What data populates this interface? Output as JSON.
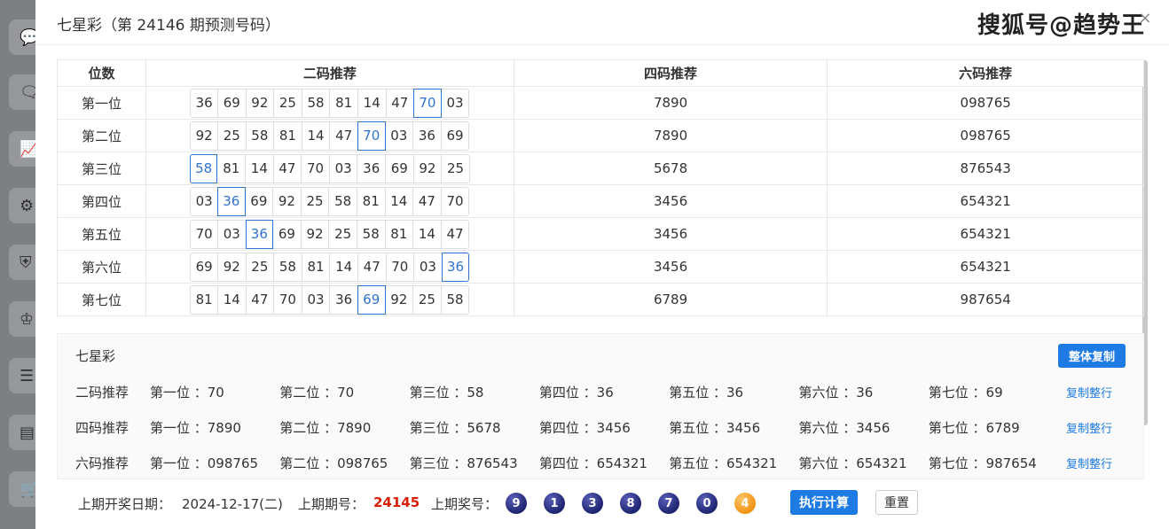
{
  "sidebar": {
    "icons": [
      "chat-icon",
      "message-heart-icon",
      "trend-chart-icon",
      "gear-icon",
      "shield-icon",
      "trophy-icon",
      "list-icon",
      "calendar-list-icon",
      "cart-icon"
    ]
  },
  "modal": {
    "title": "七星彩（第 24146 期预测号码）",
    "watermark": "搜狐号@趋势王",
    "close_label": "×"
  },
  "table": {
    "headers": {
      "pos": "位数",
      "two": "二码推荐",
      "four": "四码推荐",
      "six": "六码推荐"
    },
    "rows": [
      {
        "pos": "第一位",
        "chips": [
          "36",
          "69",
          "92",
          "25",
          "58",
          "81",
          "14",
          "47",
          "70",
          "03"
        ],
        "selected": 8,
        "four": "7890",
        "six": "098765"
      },
      {
        "pos": "第二位",
        "chips": [
          "92",
          "25",
          "58",
          "81",
          "14",
          "47",
          "70",
          "03",
          "36",
          "69"
        ],
        "selected": 6,
        "four": "7890",
        "six": "098765"
      },
      {
        "pos": "第三位",
        "chips": [
          "58",
          "81",
          "14",
          "47",
          "70",
          "03",
          "36",
          "69",
          "92",
          "25"
        ],
        "selected": 0,
        "four": "5678",
        "six": "876543"
      },
      {
        "pos": "第四位",
        "chips": [
          "03",
          "36",
          "69",
          "92",
          "25",
          "58",
          "81",
          "14",
          "47",
          "70"
        ],
        "selected": 1,
        "four": "3456",
        "six": "654321"
      },
      {
        "pos": "第五位",
        "chips": [
          "70",
          "03",
          "36",
          "69",
          "92",
          "25",
          "58",
          "81",
          "14",
          "47"
        ],
        "selected": 2,
        "four": "3456",
        "six": "654321"
      },
      {
        "pos": "第六位",
        "chips": [
          "69",
          "92",
          "25",
          "58",
          "81",
          "14",
          "47",
          "70",
          "03",
          "36"
        ],
        "selected": 9,
        "four": "3456",
        "six": "654321"
      },
      {
        "pos": "第七位",
        "chips": [
          "81",
          "14",
          "47",
          "70",
          "03",
          "36",
          "69",
          "92",
          "25",
          "58"
        ],
        "selected": 6,
        "four": "6789",
        "six": "987654"
      }
    ]
  },
  "summary": {
    "title": "七星彩",
    "copy_all_label": "整体复制",
    "copy_row_label": "复制整行",
    "rows": [
      {
        "label": "二码推荐",
        "cells": [
          "第一位 ：70",
          "第二位 ：70",
          "第三位 ：58",
          "第四位 ：36",
          "第五位 ：36",
          "第六位 ：36",
          "第七位 ：69"
        ]
      },
      {
        "label": "四码推荐",
        "cells": [
          "第一位 ：7890",
          "第二位 ：7890",
          "第三位 ：5678",
          "第四位 ：3456",
          "第五位 ：3456",
          "第六位 ：3456",
          "第七位 ：6789"
        ]
      },
      {
        "label": "六码推荐",
        "cells": [
          "第一位 ：098765",
          "第二位 ：098765",
          "第三位 ：876543",
          "第四位 ：654321",
          "第五位 ：654321",
          "第六位 ：654321",
          "第七位 ：987654"
        ]
      }
    ]
  },
  "footer": {
    "date_label": "上期开奖日期：",
    "date_value": "2024-12-17(二)",
    "issue_label": "上期期号：",
    "issue_value": "24145",
    "prize_label": "上期奖号：",
    "balls": [
      "9",
      "1",
      "3",
      "8",
      "7",
      "0",
      "4"
    ],
    "ball_colors": {
      "normal": "#1d2470",
      "special": "#ee9412"
    },
    "calc_label": "执行计算",
    "reset_label": "重置"
  },
  "colors": {
    "accent": "#1e7be4",
    "selected_chip": "#2f74d0",
    "issue_red": "#d81e06"
  }
}
